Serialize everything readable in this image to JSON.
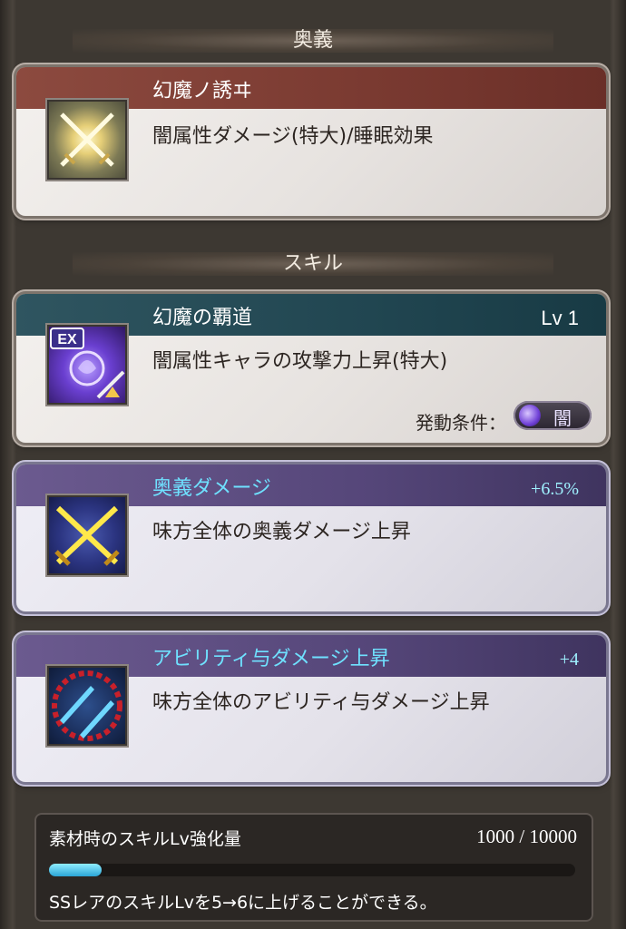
{
  "section_ougi": {
    "title": "奥義"
  },
  "ougi_card": {
    "title": "幻魔ノ誘ヰ",
    "description": "闇属性ダメージ(特大)/睡眠効果",
    "icon": "crossed-swords-icon"
  },
  "section_skill": {
    "title": "スキル"
  },
  "skill_card": {
    "title": "幻魔の覇道",
    "level": "Lv 1",
    "description": "闇属性キャラの攻撃力上昇(特大)",
    "condition_label": "発動条件：",
    "condition_value": "闇",
    "icon": "ex-skill-icon"
  },
  "bonus_cards": [
    {
      "title": "奥義ダメージ",
      "bonus": "+6.5%",
      "description": "味方全体の奥義ダメージ上昇",
      "icon": "crossed-swords-icon"
    },
    {
      "title": "アビリティ与ダメージ上昇",
      "bonus": "+4",
      "description": "味方全体のアビリティ与ダメージ上昇",
      "icon": "dual-blades-icon"
    }
  ],
  "skill_material": {
    "label": "素材時のスキルLv強化量",
    "value": "1000 / 10000",
    "progress": 0.1,
    "note": "SSレアのスキルLvを5→6に上げることができる。"
  },
  "colors": {
    "ougi_band": "#7a3a31",
    "skill_band": "#214651",
    "bonus_band": "#554679",
    "bonus_text": "#6fe1ff"
  }
}
